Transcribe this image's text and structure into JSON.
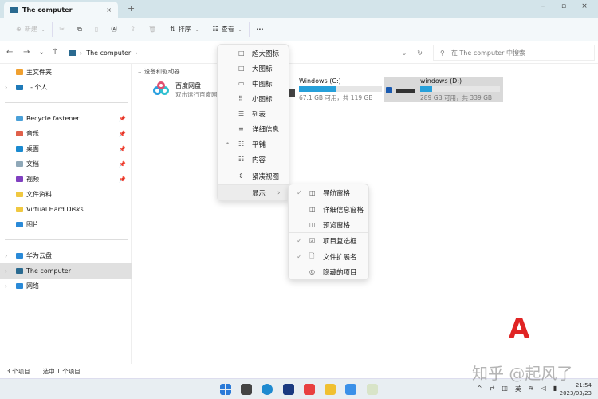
{
  "window": {
    "tab_title": "The computer",
    "close_tab": "×",
    "new_tab": "+",
    "minimize": "–",
    "maximize": "▫",
    "close": "×"
  },
  "toolbar": {
    "new": "新建",
    "sort": "排序",
    "view": "查看",
    "more": "···"
  },
  "address": {
    "path": "The computer",
    "search_placeholder": "在 The computer 中搜索"
  },
  "sidebar": {
    "items": [
      {
        "label": "主文件夹",
        "color": "#f0a030"
      },
      {
        "label": ". - 个人",
        "color": "#1f7ab8",
        "chev": true
      },
      {
        "label": "Recycle fastener",
        "color": "#4aa0d8",
        "pin": true
      },
      {
        "label": "音乐",
        "color": "#e0604a",
        "pin": true
      },
      {
        "label": "桌面",
        "color": "#1a8ad0",
        "pin": true
      },
      {
        "label": "文档",
        "color": "#8fa8b8",
        "pin": true
      },
      {
        "label": "视频",
        "color": "#8040c0",
        "pin": true
      },
      {
        "label": "文件资料",
        "color": "#f0c840"
      },
      {
        "label": "Virtual Hard Disks",
        "color": "#f0c840"
      },
      {
        "label": "图片",
        "color": "#2a8ad8"
      },
      {
        "label": "华为云盘",
        "color": "#2a8ad8",
        "chev": true
      },
      {
        "label": "The computer",
        "color": "#2a6a90",
        "chev": true,
        "selected": true
      },
      {
        "label": "网络",
        "color": "#2a8ad8",
        "chev": true
      }
    ]
  },
  "content": {
    "section": "设备和驱动器",
    "baidu": {
      "name": "百度网盘",
      "desc": "双击运行百度网"
    },
    "drives": [
      {
        "name": "Windows (C:)",
        "info": "67.1 GB 可用，共 119 GB",
        "used_fraction": 0.44
      },
      {
        "name": "windows (D:)",
        "info": "289 GB 可用，共 339 GB",
        "used_fraction": 0.15,
        "selected": true
      }
    ]
  },
  "view_menu": {
    "items": [
      {
        "label": "超大图标",
        "icon": "□"
      },
      {
        "label": "大图标",
        "icon": "□"
      },
      {
        "label": "中图标",
        "icon": "▭"
      },
      {
        "label": "小图标",
        "icon": "⠿"
      },
      {
        "label": "列表",
        "icon": "☰"
      },
      {
        "label": "详细信息",
        "icon": "≡"
      },
      {
        "label": "平铺",
        "icon": "☷",
        "bullet": "•"
      },
      {
        "label": "内容",
        "icon": "☷"
      }
    ],
    "compact": {
      "label": "紧凑视图",
      "icon": "⇕"
    },
    "show": {
      "label": "显示",
      "arrow": "›"
    }
  },
  "show_menu": {
    "items": [
      {
        "label": "导航窗格",
        "icon": "◫",
        "check": "✓"
      },
      {
        "label": "详细信息窗格",
        "icon": "◫"
      },
      {
        "label": "预览窗格",
        "icon": "◫"
      },
      {
        "label": "项目复选框",
        "icon": "☑",
        "check": "✓"
      },
      {
        "label": "文件扩展名",
        "icon": "🗋",
        "check": "✓"
      },
      {
        "label": "隐藏的项目",
        "icon": "◎"
      }
    ]
  },
  "status": {
    "count": "3 个项目",
    "selected": "选中 1 个项目"
  },
  "taskbar": {
    "time": "21:54",
    "date": "2023/03/23",
    "lang": "英"
  },
  "watermark": "知乎 @起风了",
  "annotation": "A"
}
